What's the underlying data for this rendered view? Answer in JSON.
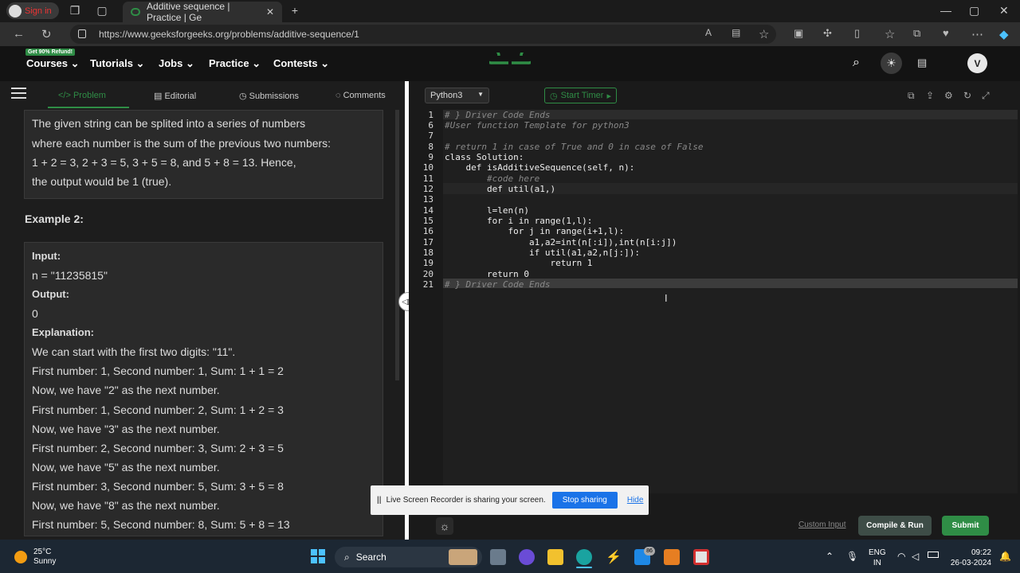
{
  "browser": {
    "sign_in": "Sign in",
    "tab_title": "Additive sequence | Practice | Ge",
    "url": "https://www.geeksforgeeks.org/problems/additive-sequence/1"
  },
  "header": {
    "promo": "Get 90% Refund!",
    "menu": [
      "Courses",
      "Tutorials",
      "Jobs",
      "Practice",
      "Contests"
    ],
    "avatar": "V"
  },
  "subtabs": [
    "Problem",
    "Editorial",
    "Submissions",
    "Comments"
  ],
  "problem": {
    "explanation1_lines": [
      "The given string can be splited into a series of numbers",
      "where each number is the sum of the previous two numbers:",
      "1 + 2 = 3, 2 + 3 = 5, 3 + 5 = 8, and 5 + 8 = 13. Hence,",
      "the output would be 1 (true)."
    ],
    "example2_title": "Example 2:",
    "input_label": "Input:",
    "input_value": "n = \"11235815\"",
    "output_label": "Output:",
    "output_value": "0",
    "explanation_label": "Explanation:",
    "explanation2_lines": [
      "We can start with the first two digits: \"11\".",
      "First number: 1, Second number: 1, Sum: 1 + 1 = 2",
      "Now, we have \"2\" as the next number.",
      "First number: 1, Second number: 2, Sum: 1 + 2 = 3",
      "Now, we have \"3\" as the next number.",
      "First number: 2, Second number: 3, Sum: 2 + 3 = 5",
      "Now, we have \"5\" as the next number.",
      "First number: 3, Second number: 5, Sum: 3 + 5 = 8",
      "Now, we have \"8\" as the next number.",
      "First number: 5, Second number: 8, Sum: 5 + 8 = 13"
    ]
  },
  "editor": {
    "language": "Python3",
    "timer": "Start Timer",
    "lines": [
      {
        "n": "1",
        "code": "# } Driver Code Ends"
      },
      {
        "n": "6",
        "code": "#User function Template for python3"
      },
      {
        "n": "7",
        "code": ""
      },
      {
        "n": "8",
        "code": "# return 1 in case of True and 0 in case of False"
      },
      {
        "n": "9",
        "code": "class Solution:"
      },
      {
        "n": "10",
        "code": "    def isAdditiveSequence(self, n):"
      },
      {
        "n": "11",
        "code": "        #code here"
      },
      {
        "n": "12",
        "code": "        def util(a1,)"
      },
      {
        "n": "13",
        "code": ""
      },
      {
        "n": "14",
        "code": "        l=len(n)"
      },
      {
        "n": "15",
        "code": "        for i in range(1,l):"
      },
      {
        "n": "16",
        "code": "            for j in range(i+1,l):"
      },
      {
        "n": "17",
        "code": "                a1,a2=int(n[:i]),int(n[i:j])"
      },
      {
        "n": "18",
        "code": "                if util(a1,a2,n[j:]):"
      },
      {
        "n": "19",
        "code": "                    return 1"
      },
      {
        "n": "20",
        "code": "        return 0"
      },
      {
        "n": "21",
        "code": "# } Driver Code Ends"
      }
    ]
  },
  "bottom": {
    "custom_input": "Custom Input",
    "compile": "Compile & Run",
    "submit": "Submit"
  },
  "share_bar": {
    "message": "Live Screen Recorder is sharing your screen.",
    "stop": "Stop sharing",
    "hide": "Hide"
  },
  "taskbar": {
    "temp": "25°C",
    "weather": "Sunny",
    "search": "Search",
    "badge": "86",
    "lang1": "ENG",
    "lang2": "IN",
    "time": "09:22",
    "date": "26-03-2024"
  }
}
